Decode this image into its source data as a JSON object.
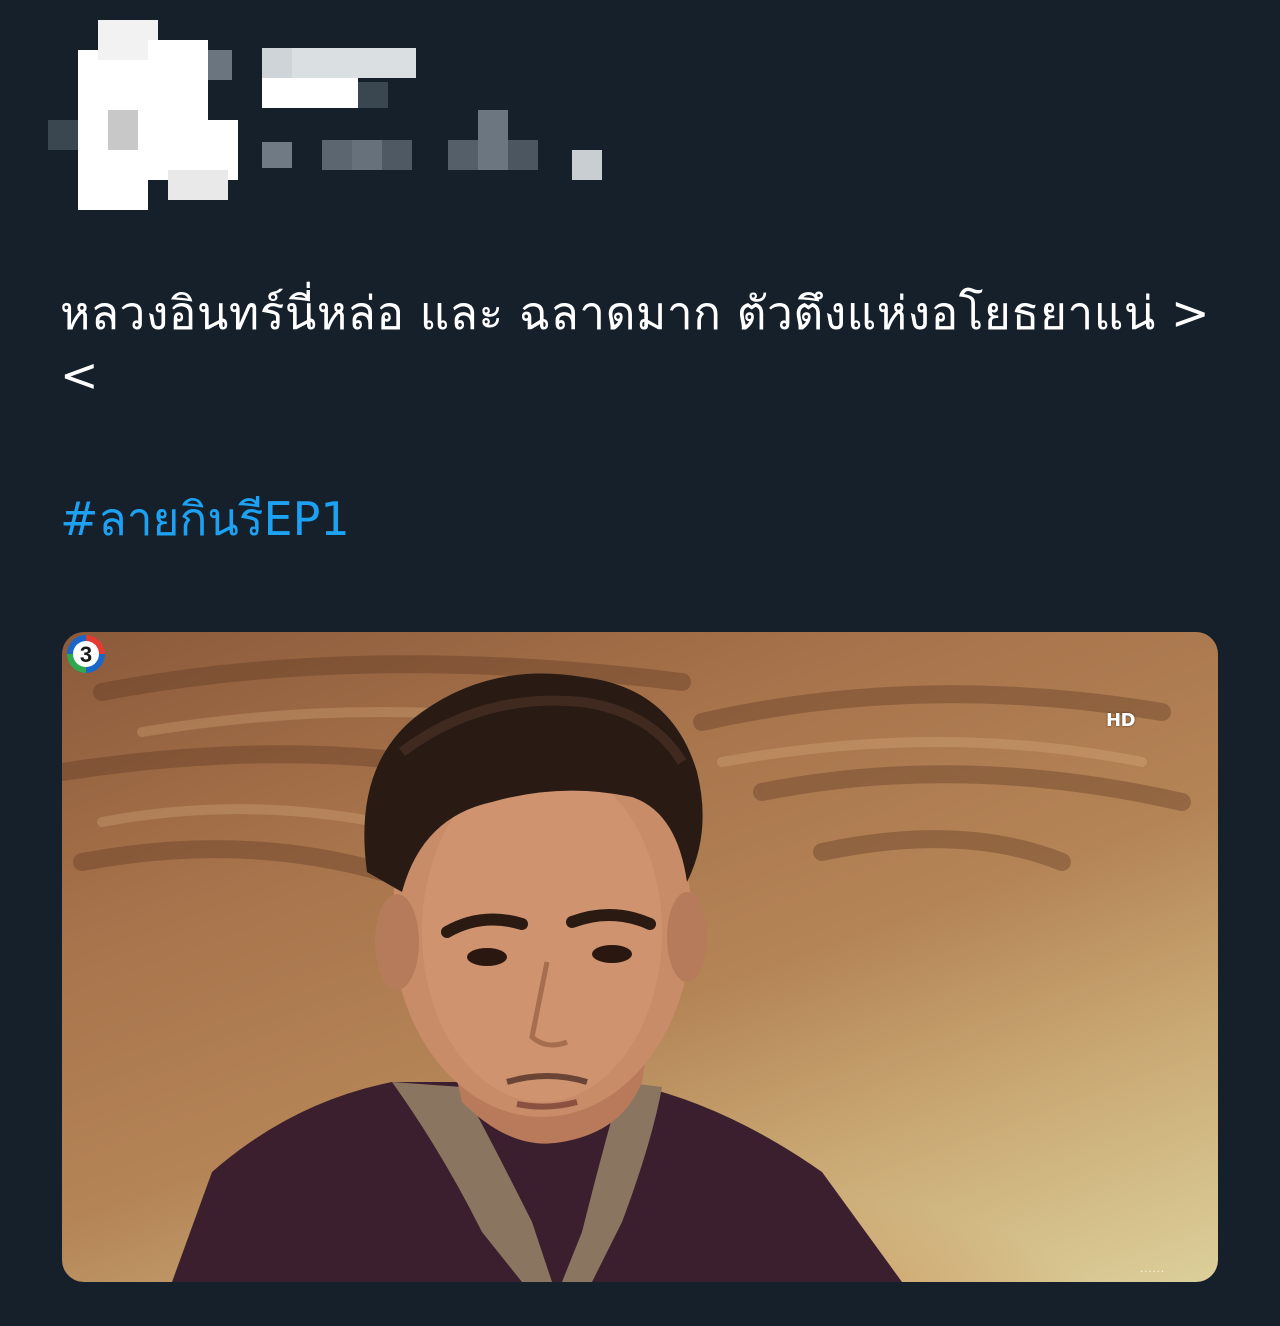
{
  "tweet": {
    "text": "หลวงอินทร์นี่หล่อ และ ฉลาดมาก ตัวตึงแห่งอโยธยาแน่ ><",
    "hashtag": "#ลายกินรีEP1"
  },
  "media": {
    "channel_logo_icon": "channel-3-logo-icon",
    "channel_badge": "HD",
    "more_indicator": "......"
  },
  "colors": {
    "background": "#15202b",
    "text": "#ffffff",
    "hashtag": "#1da1f2"
  }
}
